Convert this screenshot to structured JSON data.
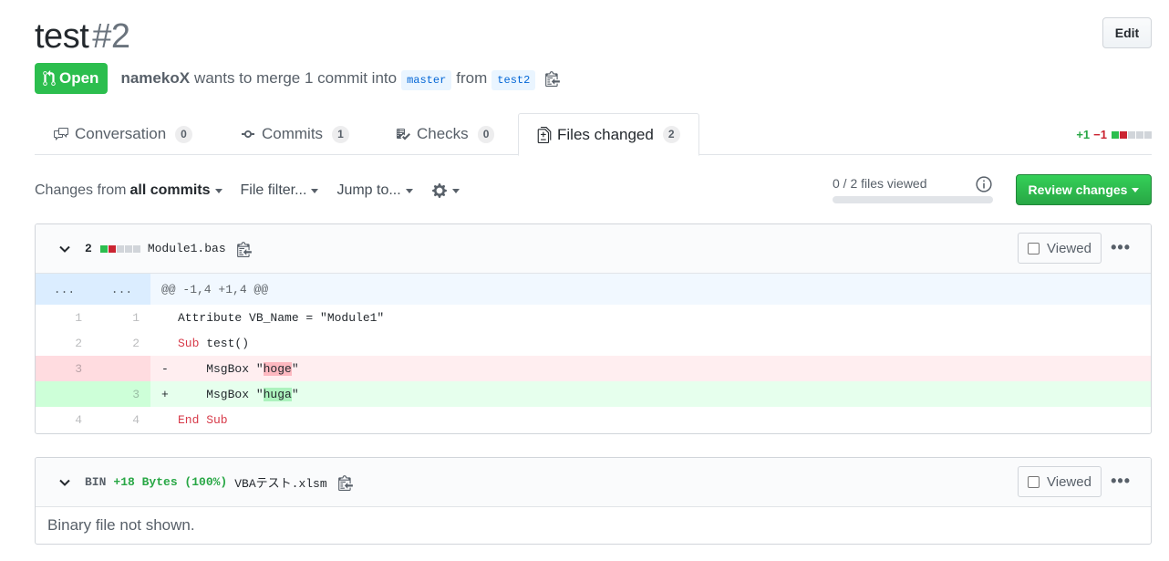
{
  "pr": {
    "title": "test",
    "number": "#2",
    "edit_label": "Edit",
    "state_label": "Open",
    "author": "namekoX",
    "merge_text": "wants to merge 1 commit into",
    "base_branch": "master",
    "from_text": "from",
    "head_branch": "test2"
  },
  "tabs": [
    {
      "label": "Conversation",
      "count": "0",
      "icon": "comment-icon"
    },
    {
      "label": "Commits",
      "count": "1",
      "icon": "commit-icon"
    },
    {
      "label": "Checks",
      "count": "0",
      "icon": "checklist-icon"
    },
    {
      "label": "Files changed",
      "count": "2",
      "icon": "file-diff-icon",
      "selected": true
    }
  ],
  "diffstat": {
    "additions": "+1",
    "deletions": "−1"
  },
  "toolbar": {
    "changes_from": "Changes from",
    "all_commits": "all commits",
    "file_filter": "File filter...",
    "jump_to": "Jump to...",
    "files_viewed": "0 / 2 files viewed",
    "files_viewed_fraction": 0,
    "review_button": "Review changes"
  },
  "files": [
    {
      "changes": "2",
      "name": "Module1.bas",
      "viewed_label": "Viewed",
      "kebab": "•••",
      "hunk_left": "...",
      "hunk_right": "...",
      "hunk_header": "@@ -1,4 +1,4 @@",
      "lines": [
        {
          "type": "ctx",
          "old": "1",
          "new": "1",
          "sign": " ",
          "pre": "Attribute VB_Name = \"Module1\"",
          "kw": "",
          "hl": "",
          "post": ""
        },
        {
          "type": "ctx",
          "old": "2",
          "new": "2",
          "sign": " ",
          "pre": "",
          "kw": "Sub",
          "hl": "",
          "post": " test()"
        },
        {
          "type": "del",
          "old": "3",
          "new": "",
          "sign": "-",
          "pre": "    MsgBox \"",
          "kw": "",
          "hl": "hoge",
          "post": "\""
        },
        {
          "type": "add",
          "old": "",
          "new": "3",
          "sign": "+",
          "pre": "    MsgBox \"",
          "kw": "",
          "hl": "huga",
          "post": "\""
        },
        {
          "type": "ctx",
          "old": "4",
          "new": "4",
          "sign": " ",
          "pre": "",
          "kw": "End Sub",
          "hl": "",
          "post": ""
        }
      ]
    },
    {
      "bin_label": "BIN",
      "bytes": "+18 Bytes (100%)",
      "name": "VBAテスト.xlsm",
      "viewed_label": "Viewed",
      "kebab": "•••",
      "body": "Binary file not shown."
    }
  ],
  "colors": {
    "open_green": "#2cbe4e",
    "addition": "#28a745",
    "deletion": "#cb2431",
    "link": "#0366d6"
  }
}
